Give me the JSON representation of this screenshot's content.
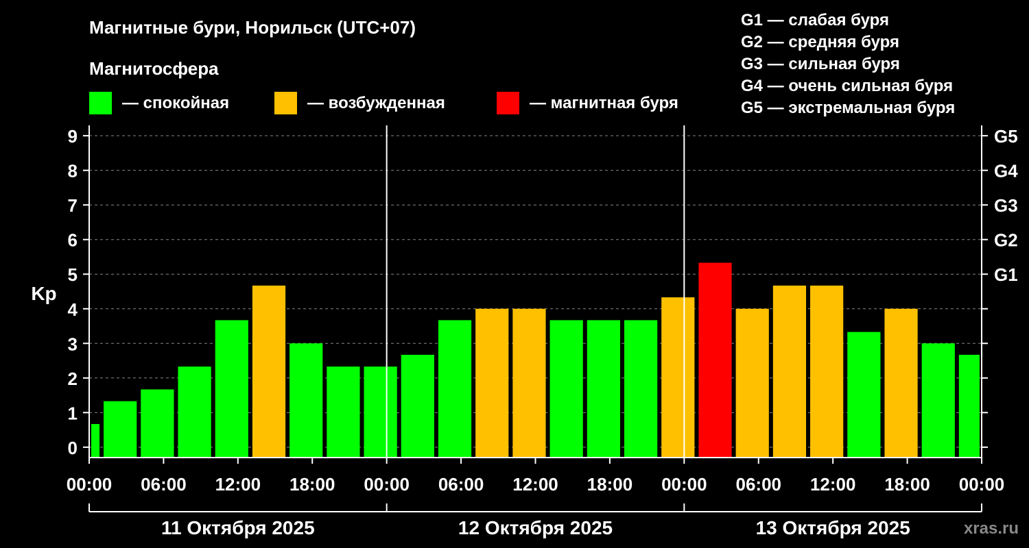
{
  "title": "Магнитные бури, Норильск (UTC+07)",
  "magnetosphere_heading": "Магнитосфера",
  "legend": [
    {
      "label": "— спокойная",
      "color": "#00ff00"
    },
    {
      "label": "— возбужденная",
      "color": "#ffc000"
    },
    {
      "label": "— магнитная буря",
      "color": "#ff0000"
    }
  ],
  "storm_levels": [
    "G1 — слабая буря",
    "G2 — средняя буря",
    "G3 — сильная буря",
    "G4 — очень сильная буря",
    "G5 — экстремальная буря"
  ],
  "watermark": "xras.ru",
  "chart_data": {
    "type": "bar",
    "ylabel": "Kp",
    "ylim": [
      -0.3,
      9.3
    ],
    "y_ticks": [
      "0",
      "1",
      "2",
      "3",
      "4",
      "5",
      "6",
      "7",
      "8",
      "9"
    ],
    "right_ticks": [
      {
        "kp": 5,
        "label": "G1"
      },
      {
        "kp": 6,
        "label": "G2"
      },
      {
        "kp": 7,
        "label": "G3"
      },
      {
        "kp": 8,
        "label": "G4"
      },
      {
        "kp": 9,
        "label": "G5"
      }
    ],
    "x_tick_labels": [
      "00:00",
      "06:00",
      "12:00",
      "18:00",
      "00:00",
      "06:00",
      "12:00",
      "18:00",
      "00:00",
      "06:00",
      "12:00",
      "18:00",
      "00:00"
    ],
    "x_tick_hours": [
      0,
      6,
      12,
      18,
      24,
      30,
      36,
      42,
      48,
      54,
      60,
      66,
      72
    ],
    "days": [
      {
        "label": "11 Октября 2025",
        "start_hour": 0,
        "end_hour": 24
      },
      {
        "label": "12 Октября 2025",
        "start_hour": 24,
        "end_hour": 48
      },
      {
        "label": "13 Октября 2025",
        "start_hour": 48,
        "end_hour": 72
      }
    ],
    "grid": "dashed horizontal at each Kp",
    "series": [
      {
        "bars": [
          {
            "start_hour": 0,
            "end_hour": 1,
            "kp": 0.67,
            "level": "quiet"
          },
          {
            "start_hour": 1,
            "end_hour": 4,
            "kp": 1.33,
            "level": "quiet"
          },
          {
            "start_hour": 4,
            "end_hour": 7,
            "kp": 1.67,
            "level": "quiet"
          },
          {
            "start_hour": 7,
            "end_hour": 10,
            "kp": 2.33,
            "level": "quiet"
          },
          {
            "start_hour": 10,
            "end_hour": 13,
            "kp": 3.67,
            "level": "quiet"
          },
          {
            "start_hour": 13,
            "end_hour": 16,
            "kp": 4.67,
            "level": "active"
          },
          {
            "start_hour": 16,
            "end_hour": 19,
            "kp": 3.0,
            "level": "quiet"
          },
          {
            "start_hour": 19,
            "end_hour": 22,
            "kp": 2.33,
            "level": "quiet"
          },
          {
            "start_hour": 22,
            "end_hour": 25,
            "kp": 2.33,
            "level": "quiet"
          },
          {
            "start_hour": 25,
            "end_hour": 28,
            "kp": 2.67,
            "level": "quiet"
          },
          {
            "start_hour": 28,
            "end_hour": 31,
            "kp": 3.67,
            "level": "quiet"
          },
          {
            "start_hour": 31,
            "end_hour": 34,
            "kp": 4.0,
            "level": "active"
          },
          {
            "start_hour": 34,
            "end_hour": 37,
            "kp": 4.0,
            "level": "active"
          },
          {
            "start_hour": 37,
            "end_hour": 40,
            "kp": 3.67,
            "level": "quiet"
          },
          {
            "start_hour": 40,
            "end_hour": 43,
            "kp": 3.67,
            "level": "quiet"
          },
          {
            "start_hour": 43,
            "end_hour": 46,
            "kp": 3.67,
            "level": "quiet"
          },
          {
            "start_hour": 46,
            "end_hour": 49,
            "kp": 4.33,
            "level": "active"
          },
          {
            "start_hour": 49,
            "end_hour": 52,
            "kp": 5.33,
            "level": "storm"
          },
          {
            "start_hour": 52,
            "end_hour": 55,
            "kp": 4.0,
            "level": "active"
          },
          {
            "start_hour": 55,
            "end_hour": 58,
            "kp": 4.67,
            "level": "active"
          },
          {
            "start_hour": 58,
            "end_hour": 61,
            "kp": 4.67,
            "level": "active"
          },
          {
            "start_hour": 61,
            "end_hour": 64,
            "kp": 3.33,
            "level": "quiet"
          },
          {
            "start_hour": 64,
            "end_hour": 67,
            "kp": 4.0,
            "level": "active"
          },
          {
            "start_hour": 67,
            "end_hour": 70,
            "kp": 3.0,
            "level": "quiet"
          },
          {
            "start_hour": 70,
            "end_hour": 72,
            "kp": 2.67,
            "level": "quiet"
          }
        ]
      }
    ],
    "level_colors": {
      "quiet": "#00ff00",
      "active": "#ffc000",
      "storm": "#ff0000"
    }
  }
}
